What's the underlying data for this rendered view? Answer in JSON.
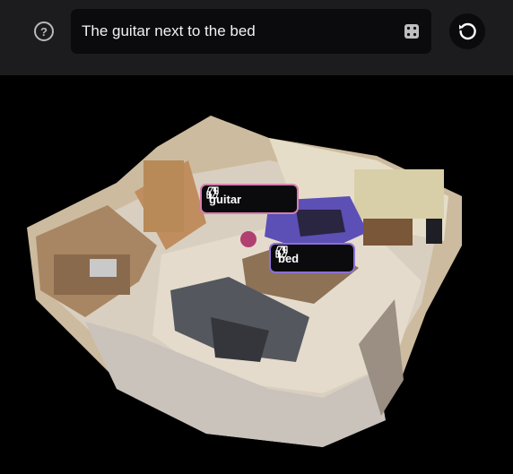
{
  "toolbar": {
    "help_icon": "question-circle-icon",
    "query": "The guitar next to the bed",
    "dice_icon": "dice-icon",
    "reset_icon": "reset-icon"
  },
  "labels": [
    {
      "name": "guitar",
      "color": "#d67fb0",
      "icons": [
        "thumbs-up-icon",
        "thumbs-down-icon"
      ]
    },
    {
      "name": "bed",
      "color": "#8c6fd8",
      "icons": [
        "thumbs-up-icon",
        "thumbs-down-icon"
      ]
    }
  ]
}
